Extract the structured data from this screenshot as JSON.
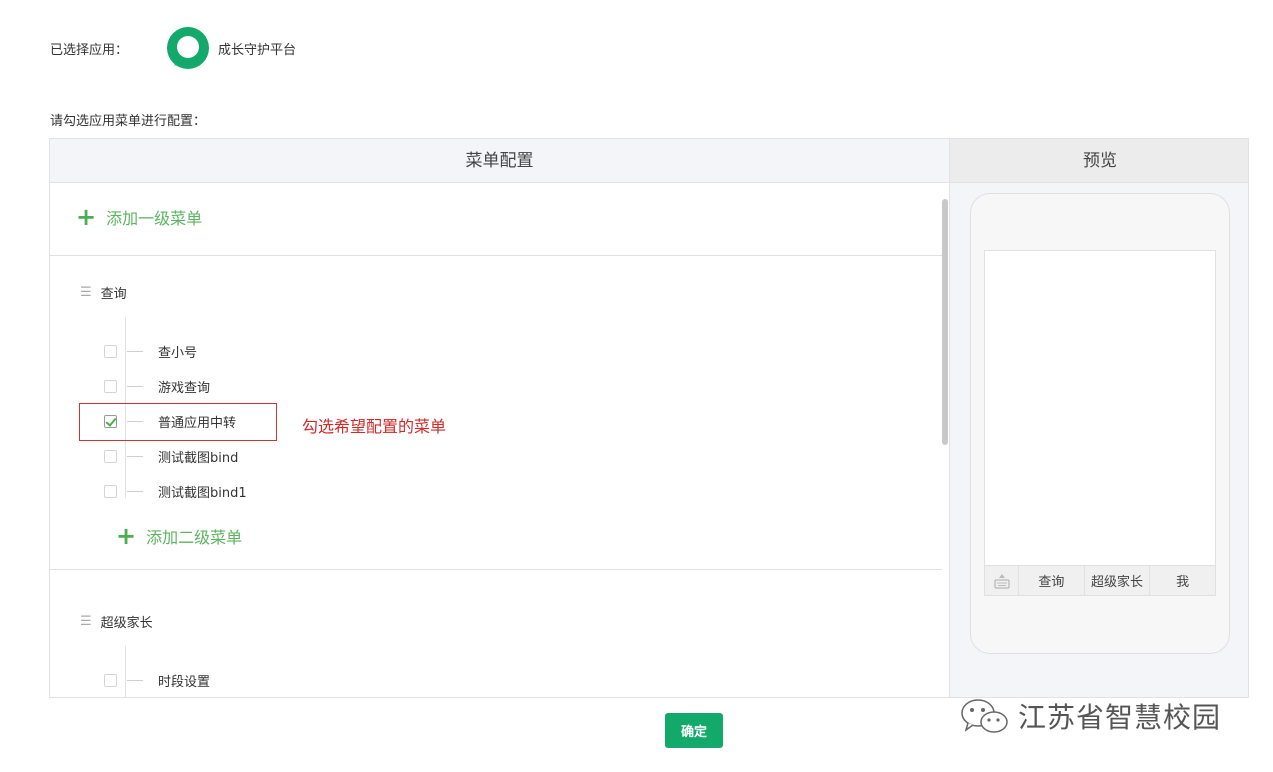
{
  "selected_app": {
    "label": "已选择应用：",
    "app_name": "成长守护平台",
    "logo_icon": "app-logo-icon",
    "logo_color": "#13a96b"
  },
  "hint": "请勾选应用菜单进行配置：",
  "menu_panel": {
    "header": "菜单配置",
    "add_level1_label": "添加一级菜单",
    "groups": [
      {
        "title": "查询",
        "items": [
          {
            "label": "查小号",
            "checked": false
          },
          {
            "label": "游戏查询",
            "checked": false
          },
          {
            "label": "普通应用中转",
            "checked": true
          },
          {
            "label": "测试截图bind",
            "checked": false
          },
          {
            "label": "测试截图bind1",
            "checked": false
          }
        ],
        "add_level2_label": "添加二级菜单"
      },
      {
        "title": "超级家长",
        "items": [
          {
            "label": "时段设置",
            "checked": false
          }
        ]
      }
    ],
    "annotation": "勾选希望配置的菜单"
  },
  "preview_panel": {
    "header": "预览",
    "menu_items": [
      "查询",
      "超级家长",
      "我"
    ],
    "keyboard_icon": "keyboard-icon"
  },
  "confirm_button": "确定",
  "watermark": "江苏省智慧校园",
  "colors": {
    "accent_green": "#4cae50",
    "button_green": "#13a96b",
    "annotation_red": "#d02a2a"
  }
}
